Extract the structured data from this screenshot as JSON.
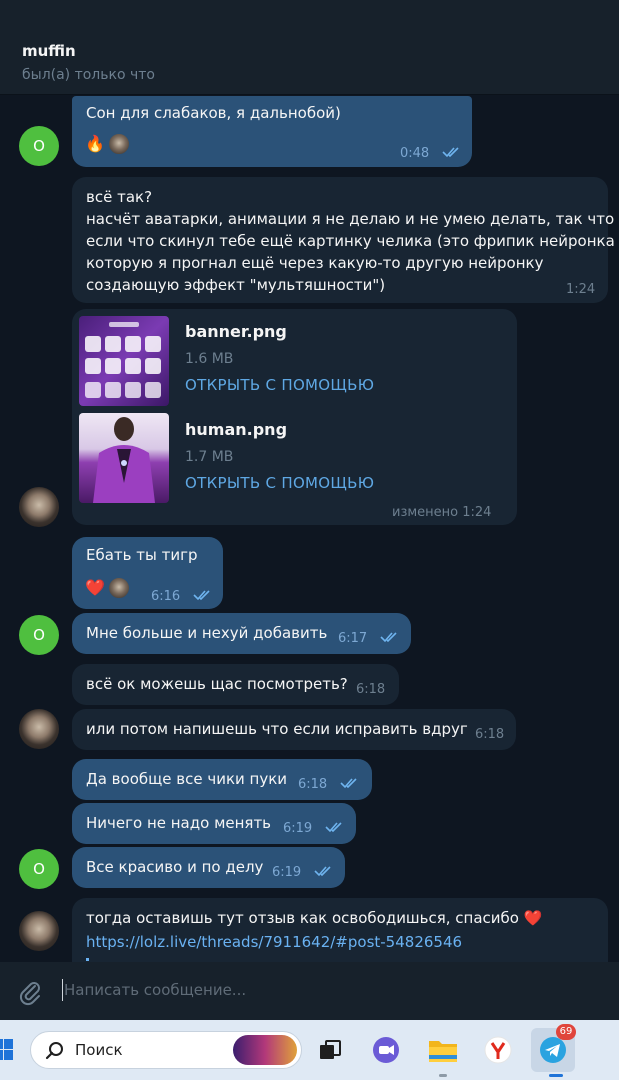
{
  "header": {
    "title": "muffin",
    "status": "был(а) только что"
  },
  "messages": [
    {
      "text": "Сон для слабаков, я дальнобой)",
      "time": "0:48",
      "reaction": "🔥"
    },
    {
      "lines": [
        "всё так?",
        "насчёт аватарки, анимации я не делаю и не умею делать, так что",
        "если что скинул тебе ещё картинку челика (это фрипик нейронка",
        "которую я прогнал ещё через какую-то другую нейронку",
        "создающую эффект \"мультяшности\")"
      ],
      "time": "1:24"
    },
    {
      "files": [
        {
          "name": "banner.png",
          "size": "1.6 MB",
          "action": "ОТКРЫТЬ С ПОМОЩЬЮ"
        },
        {
          "name": "human.png",
          "size": "1.7 MB",
          "action": "ОТКРЫТЬ С ПОМОЩЬЮ"
        }
      ],
      "time": "изменено 1:24"
    },
    {
      "text": "Ебать ты тигр",
      "time": "6:16",
      "reaction": "❤️"
    },
    {
      "text": "Мне больше и нехуй добавить",
      "time": "6:17"
    },
    {
      "text": "всё ок можешь щас посмотреть?",
      "time": "6:18"
    },
    {
      "text": "или потом напишешь что если исправить вдруг",
      "time": "6:18"
    },
    {
      "text": "Да вообще все чики пуки",
      "time": "6:18"
    },
    {
      "text": "Ничего не надо менять",
      "time": "6:19"
    },
    {
      "text": "Все красиво и по делу",
      "time": "6:19"
    },
    {
      "text": "тогда оставишь тут отзыв как освободишься, спасибо ❤️",
      "link": "https://lolz.live/threads/7911642/#post-54826546"
    }
  ],
  "avatar_letter": "O",
  "composer": {
    "placeholder": "Написать сообщение..."
  },
  "taskbar": {
    "search_label": "Поиск",
    "telegram_badge": "69"
  },
  "colors": {
    "background": "#0e1621",
    "outgoing_bubble": "#2b5278",
    "incoming_bubble": "#182533",
    "read_checks": "#6fb4ef",
    "link": "#6ab2f2",
    "avatar_green": "#4fbf3f"
  },
  "icons": {
    "attach": "paperclip-icon",
    "search": "search-icon",
    "read": "double-check-icon",
    "windows": "windows-logo-icon",
    "telegram": "telegram-icon"
  }
}
